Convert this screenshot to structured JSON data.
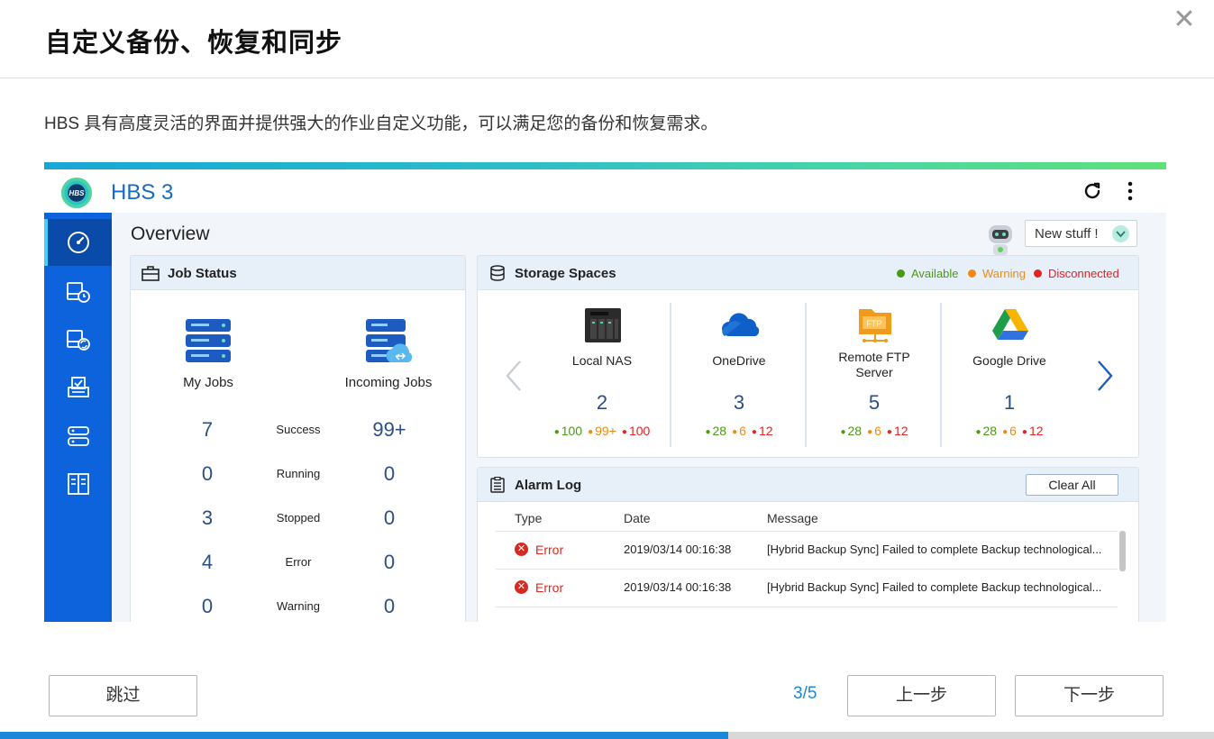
{
  "dialog": {
    "title": "自定义备份、恢复和同步",
    "close_label": "✕",
    "description": "HBS 具有高度灵活的界面并提供强大的作业自定义功能，可以满足您的备份和恢复需求。"
  },
  "app": {
    "logo_text": "HBS",
    "name": "HBS 3",
    "overview_title": "Overview",
    "new_stuff_label": "New stuff !",
    "sidebar_icons": [
      "overview-icon",
      "backup-restore-icon",
      "sync-icon",
      "job-list-icon",
      "storage-icon",
      "services-icon"
    ]
  },
  "job_status": {
    "title": "Job Status",
    "columns": [
      "My Jobs",
      "Incoming Jobs"
    ],
    "rows": [
      {
        "label": "Success",
        "my": "7",
        "incoming": "99+"
      },
      {
        "label": "Running",
        "my": "0",
        "incoming": "0"
      },
      {
        "label": "Stopped",
        "my": "3",
        "incoming": "0"
      },
      {
        "label": "Error",
        "my": "4",
        "incoming": "0"
      },
      {
        "label": "Warning",
        "my": "0",
        "incoming": "0"
      }
    ]
  },
  "storage": {
    "title": "Storage Spaces",
    "legend": [
      {
        "label": "Available",
        "color": "#4a9a16"
      },
      {
        "label": "Warning",
        "color": "#f08a12"
      },
      {
        "label": "Disconnected",
        "color": "#e02424"
      }
    ],
    "items": [
      {
        "name": "Local NAS",
        "count": "2",
        "green": "100",
        "orange": "99+",
        "red": "100",
        "icon": "nas-icon"
      },
      {
        "name": "OneDrive",
        "count": "3",
        "green": "28",
        "orange": "6",
        "red": "12",
        "icon": "onedrive-icon"
      },
      {
        "name": "Remote FTP Server",
        "count": "5",
        "green": "28",
        "orange": "6",
        "red": "12",
        "icon": "ftp-server-icon"
      },
      {
        "name": "Google Drive",
        "count": "1",
        "green": "28",
        "orange": "6",
        "red": "12",
        "icon": "google-drive-icon"
      }
    ]
  },
  "alarm_log": {
    "title": "Alarm Log",
    "clear_all_label": "Clear All",
    "headers": [
      "Type",
      "Date",
      "Message"
    ],
    "rows": [
      {
        "type": "Error",
        "date": "2019/03/14 00:16:38",
        "message": "[Hybrid Backup Sync] Failed to complete Backup technological..."
      },
      {
        "type": "Error",
        "date": "2019/03/14 00:16:38",
        "message": "[Hybrid Backup Sync] Failed to complete Backup technological..."
      }
    ]
  },
  "footer": {
    "skip_label": "跳过",
    "step_indicator": "3/5",
    "prev_label": "上一步",
    "next_label": "下一步",
    "progress_fraction": 0.6
  },
  "colors": {
    "accent": "#1a87d9",
    "sidebar": "#0d63dc",
    "error": "#d9281f"
  }
}
